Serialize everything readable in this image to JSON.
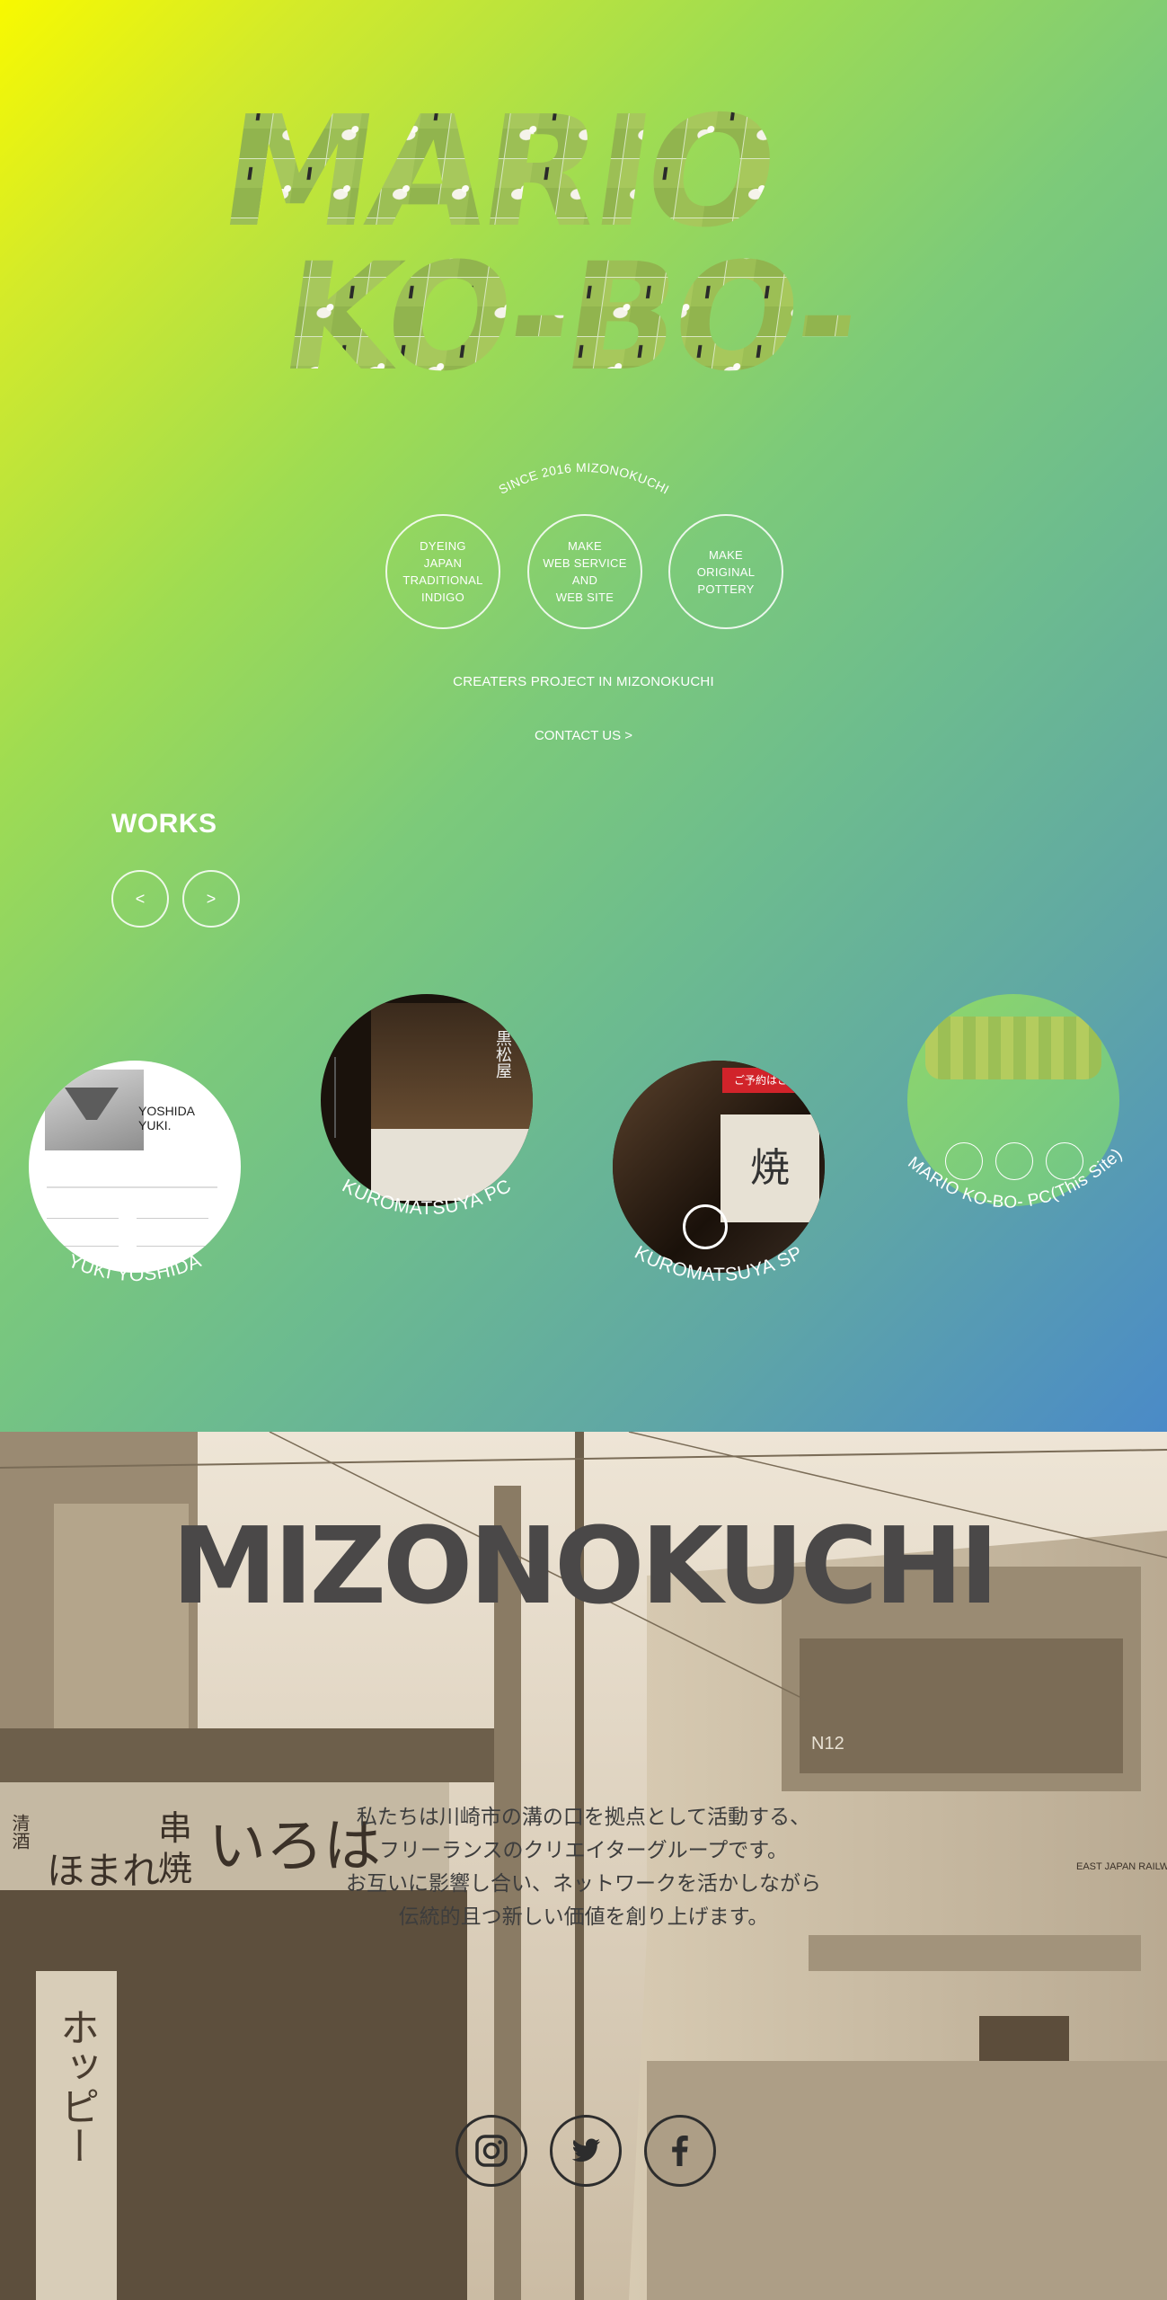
{
  "hero": {
    "logo_text_line1": "MARIO",
    "logo_text_line2": "KO-BO-",
    "since": "SINCE 2016 MIZONOKUCHI",
    "services": [
      {
        "label": "DYEING\nJAPAN\nTRADITIONAL\nINDIGO"
      },
      {
        "label": "MAKE\nWEB SERVICE\nAND\nWEB SITE"
      },
      {
        "label": "MAKE\nORIGINAL\nPOTTERY"
      }
    ],
    "creaters": "CREATERS PROJECT IN MIZONOKUCHI",
    "contact": "CONTACT US  >",
    "colors": {
      "gradient_start": "#f8f900",
      "gradient_end": "#4a8ac8",
      "text": "#ffffff"
    }
  },
  "works": {
    "title": "WORKS",
    "prev_label": "<",
    "next_label": ">",
    "items": [
      {
        "label": "YUKI YOSHIDA",
        "thumb_text": "YOSHIDA YUKI."
      },
      {
        "label": "KUROMATSUYA PC",
        "thumb_text": "黒松屋"
      },
      {
        "label": "KUROMATSUYA SP",
        "thumb_text": "ご予約はこちら",
        "thumb_text2": "焼"
      },
      {
        "label": "MARIO KO-BO- PC(This Site)"
      }
    ]
  },
  "about": {
    "title": "MIZONOKUCHI",
    "intro_lines": [
      "私たちは川崎市の溝の口を拠点として活動する、",
      "フリーランスのクリエイターグループです。",
      "お互いに影響し合い、ネットワークを活かしながら",
      "伝統的且つ新しい価値を創り上げます。"
    ],
    "photo_signs": [
      "串",
      "焼",
      "いろは",
      "ホッピー",
      "清酒",
      "ほまれ",
      "N12",
      "EAST JAPAN RAILWAY"
    ],
    "social": [
      {
        "icon": "instagram-icon"
      },
      {
        "icon": "twitter-icon"
      },
      {
        "icon": "facebook-icon"
      }
    ]
  }
}
